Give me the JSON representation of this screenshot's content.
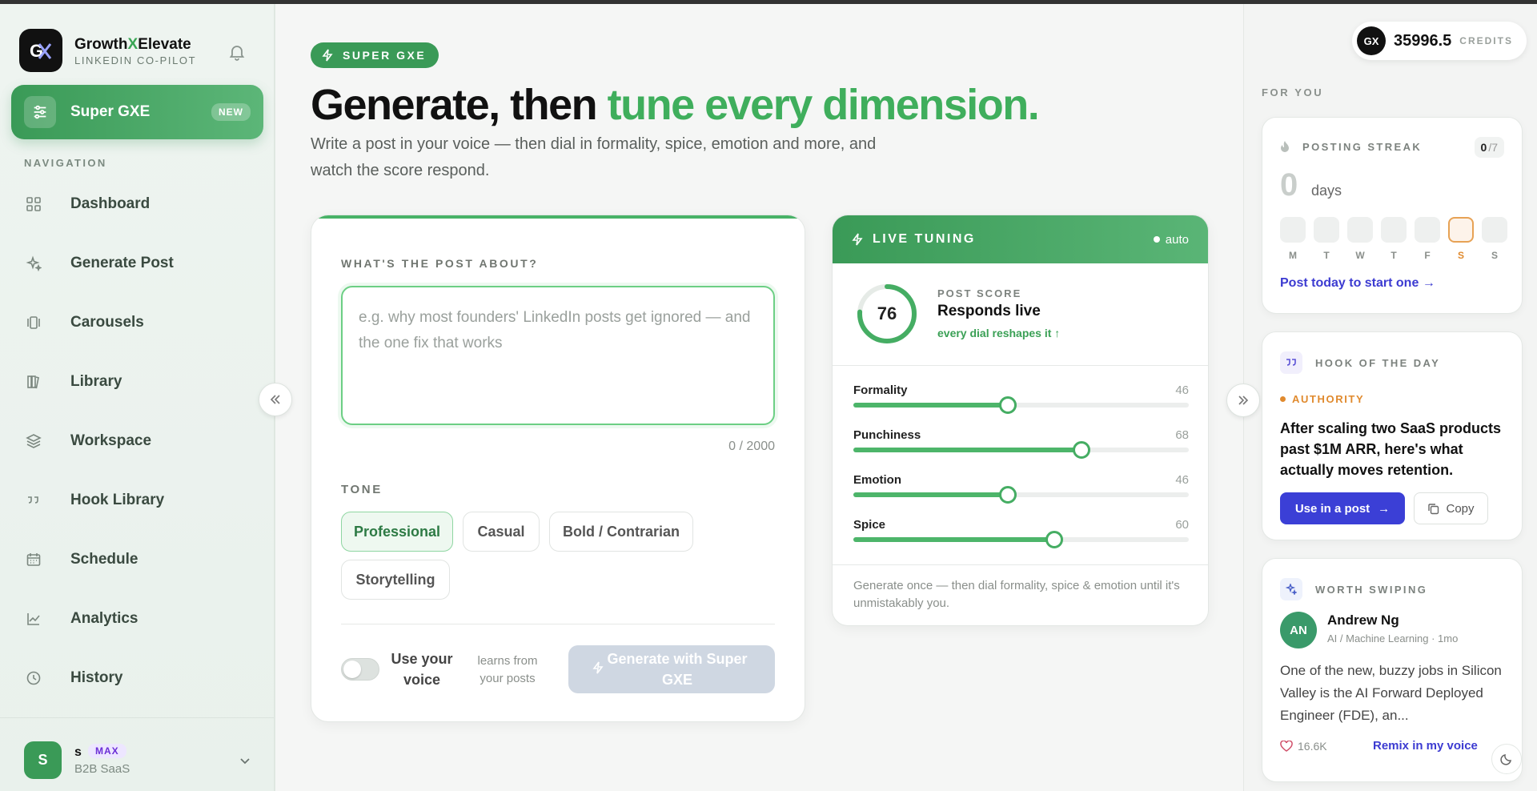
{
  "brand": {
    "name_pre": "Growth",
    "name_x": "X",
    "name_post": "Elevate",
    "subtitle": "LINKEDIN CO-PILOT",
    "logo": "GX"
  },
  "super": {
    "label": "Super GXE",
    "badge": "NEW"
  },
  "nav": {
    "heading": "NAVIGATION",
    "items": [
      {
        "label": "Dashboard",
        "icon": "grid-icon"
      },
      {
        "label": "Generate Post",
        "icon": "sparkle-icon"
      },
      {
        "label": "Carousels",
        "icon": "carousel-icon"
      },
      {
        "label": "Library",
        "icon": "books-icon"
      },
      {
        "label": "Workspace",
        "icon": "layers-icon"
      },
      {
        "label": "Hook Library",
        "icon": "quote-icon"
      },
      {
        "label": "Schedule",
        "icon": "calendar-icon"
      },
      {
        "label": "Analytics",
        "icon": "chart-icon"
      },
      {
        "label": "History",
        "icon": "clock-icon"
      }
    ]
  },
  "user": {
    "initial": "S",
    "name": "s",
    "plan": "MAX",
    "org": "B2B SaaS"
  },
  "hero": {
    "pill": "SUPER GXE",
    "title_a": "Generate, then ",
    "title_b": "tune every dimension.",
    "subtitle": "Write a post in your voice — then dial in formality, spice, emotion and more, and watch the score respond."
  },
  "composer": {
    "about_label": "WHAT'S THE POST ABOUT?",
    "placeholder": "e.g. why most founders' LinkedIn posts get ignored — and the one fix that works",
    "counter": "0 / 2000",
    "tone_label": "TONE",
    "tones": [
      "Professional",
      "Casual",
      "Bold / Contrarian",
      "Storytelling"
    ],
    "selected_tone": "Professional",
    "voice_label": "Use your voice",
    "voice_sub": "learns from your posts",
    "voice_enabled": false,
    "generate_label": "Generate with Super GXE"
  },
  "tuning": {
    "title": "LIVE TUNING",
    "auto": "auto",
    "score": "76",
    "score_label": "POST SCORE",
    "score_title": "Responds live",
    "score_sub": "every dial reshapes it ↑",
    "dials": [
      {
        "name": "Formality",
        "value": 46
      },
      {
        "name": "Punchiness",
        "value": 68
      },
      {
        "name": "Emotion",
        "value": 46
      },
      {
        "name": "Spice",
        "value": 60
      }
    ],
    "footer": "Generate once — then dial formality, spice & emotion until it's unmistakably you."
  },
  "credits": {
    "logo": "GX",
    "value": "35996.5",
    "label": "CREDITS"
  },
  "for_you": "FOR YOU",
  "streak": {
    "title": "POSTING STREAK",
    "count": "0",
    "total": "/7",
    "days_num": "0",
    "days_label": "days",
    "days": [
      "M",
      "T",
      "W",
      "T",
      "F",
      "S",
      "S"
    ],
    "today_index": 5,
    "link": "Post today to start one"
  },
  "hook": {
    "title": "HOOK OF THE DAY",
    "tag": "AUTHORITY",
    "text": "After scaling two SaaS products past $1M ARR, here's what actually moves retention.",
    "use_label": "Use in a post",
    "copy_label": "Copy"
  },
  "swipe": {
    "title": "WORTH SWIPING",
    "initials": "AN",
    "name": "Andrew Ng",
    "meta": "AI / Machine Learning · 1mo",
    "body": "One of the new, buzzy jobs in Silicon Valley is the AI Forward Deployed Engineer (FDE), an...",
    "likes": "16.6K",
    "remix": "Remix in my voice"
  },
  "colors": {
    "accent": "#3a9a57",
    "accent_light": "#5cb678",
    "link": "#3c3bd1",
    "streak_today": "#e08a2e"
  }
}
